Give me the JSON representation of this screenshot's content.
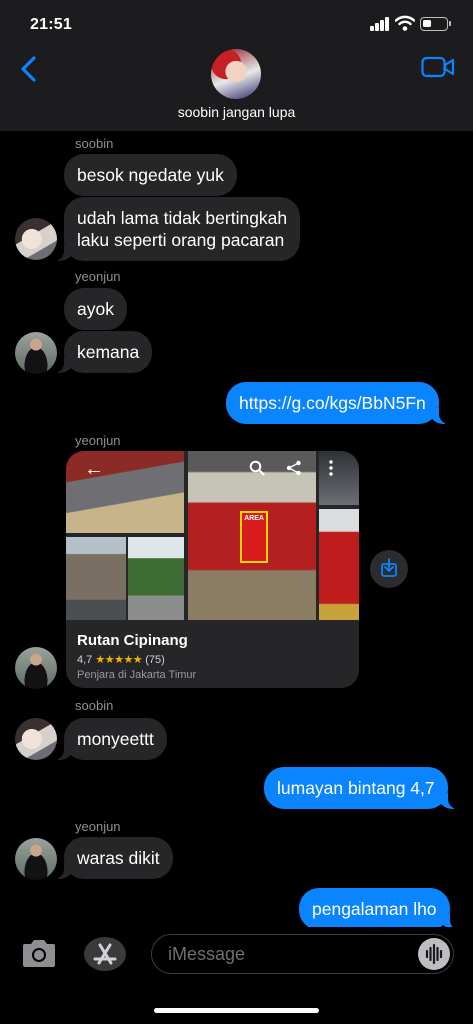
{
  "status_bar": {
    "time": "21:51"
  },
  "header": {
    "contact_name": "soobin jangan lupa"
  },
  "messages": {
    "m1_sender": "soobin",
    "m1_text": "besok ngedate yuk",
    "m2_line1": "udah lama tidak bertingkah",
    "m2_line2": "laku seperti orang pacaran",
    "m3_sender": "yeonjun",
    "m3_text": "ayok",
    "m4_text": "kemana",
    "m5_text": "https://g.co/kgs/BbN5Fn",
    "m6_sender": "yeonjun",
    "m8_sender": "soobin",
    "m8_text": "monyeettt",
    "m9_text": "lumayan bintang 4,7",
    "m10_sender": "yeonjun",
    "m10_text": "waras dikit",
    "m11_text": "pengalaman lho"
  },
  "link_card": {
    "title": "Rutan Cipinang",
    "rating": "4,7",
    "stars": "★★★★★",
    "reviews": "(75)",
    "subtitle": "Penjara di Jakarta Timur",
    "sign_text": "AREA"
  },
  "input_bar": {
    "placeholder": "iMessage"
  },
  "icons": [
    "back-icon",
    "video-call-icon",
    "camera-icon",
    "appstore-icon",
    "audio-message-icon",
    "save-link-icon",
    "search-icon",
    "share-icon",
    "more-icon"
  ]
}
